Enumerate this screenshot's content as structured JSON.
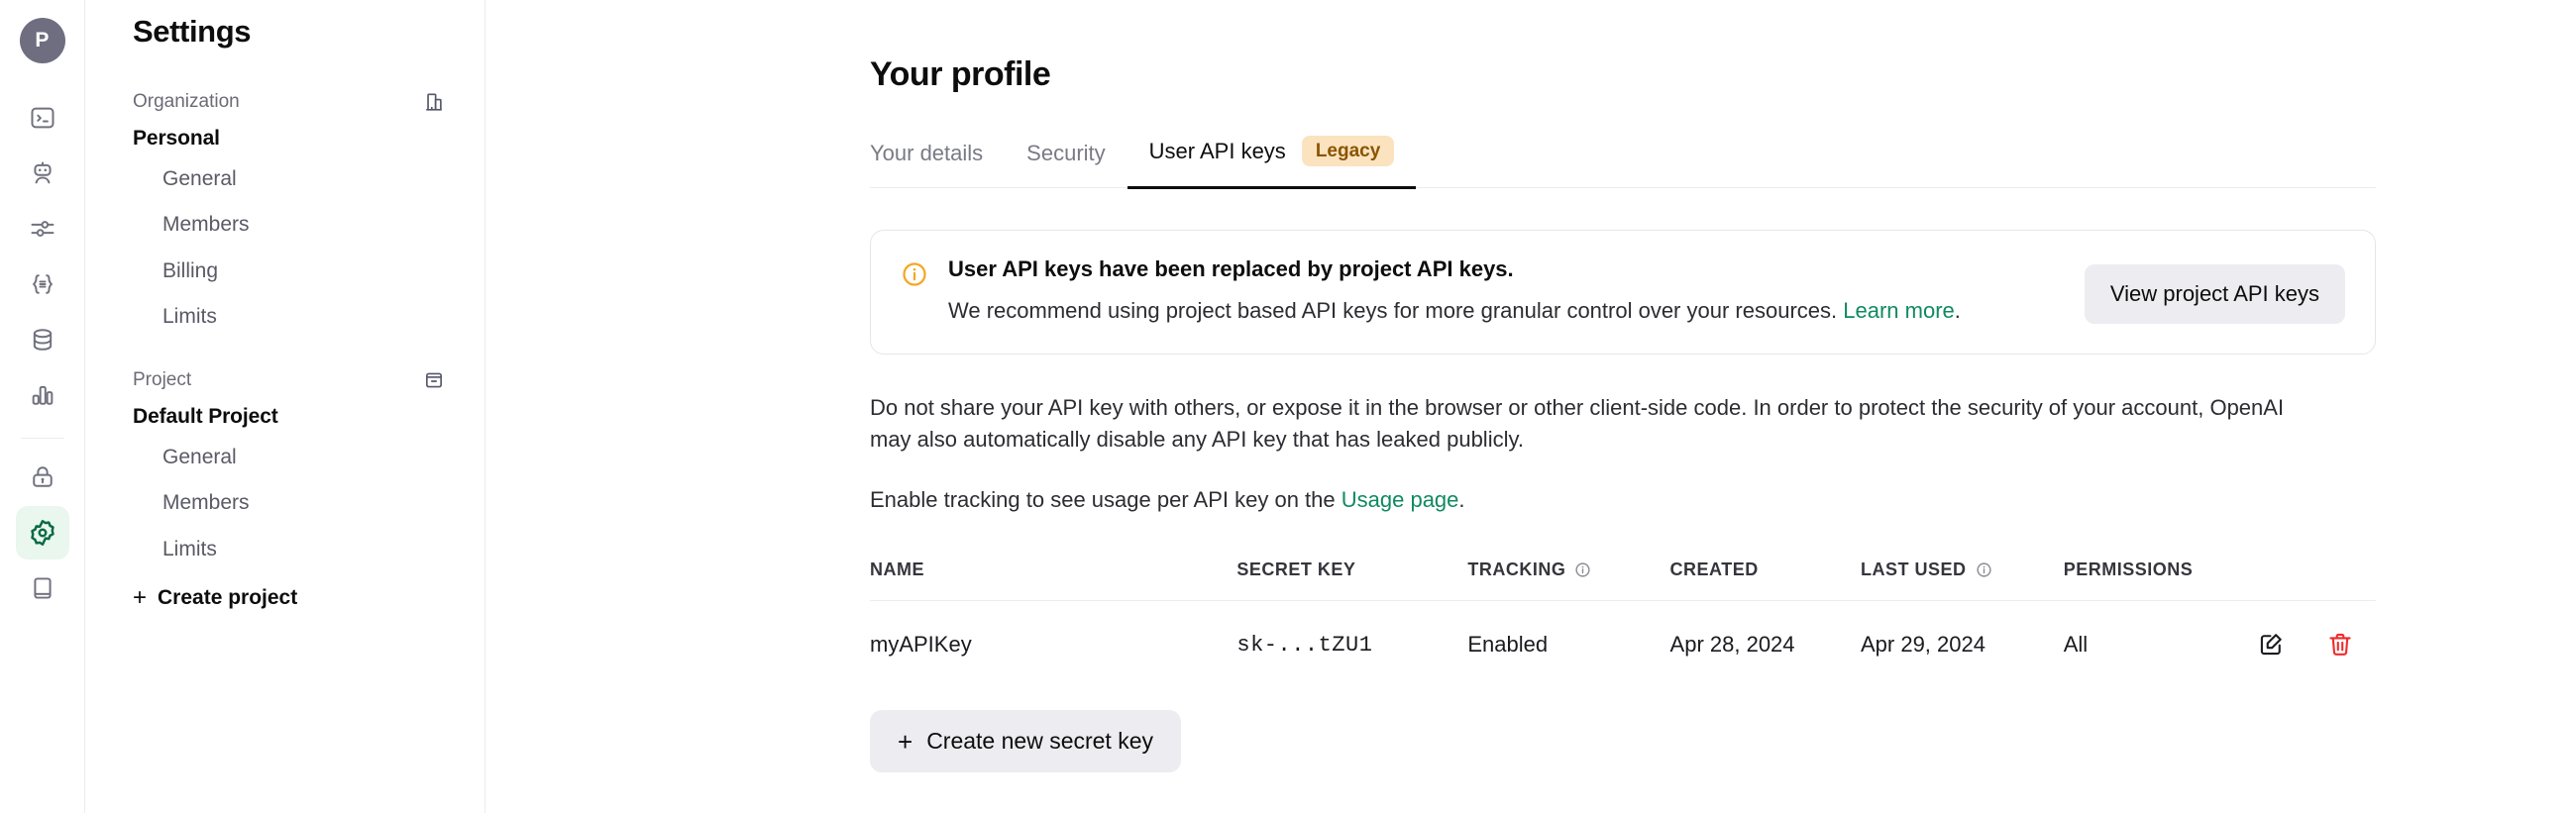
{
  "rail": {
    "avatar_initial": "P",
    "items": [
      {
        "name": "playground-icon",
        "title": "Playground"
      },
      {
        "name": "assistants-icon",
        "title": "Assistants"
      },
      {
        "name": "fine-tuning-icon",
        "title": "Fine-tuning"
      },
      {
        "name": "batches-icon",
        "title": "Batches"
      },
      {
        "name": "storage-icon",
        "title": "Storage"
      },
      {
        "name": "usage-icon",
        "title": "Usage"
      }
    ],
    "lower_items": [
      {
        "name": "api-keys-icon",
        "title": "API keys"
      },
      {
        "name": "settings-gear-icon",
        "title": "Settings",
        "active": true
      },
      {
        "name": "docs-book-icon",
        "title": "Docs"
      }
    ]
  },
  "nav": {
    "title": "Settings",
    "organization": {
      "label": "Organization",
      "icon": "building-icon",
      "name": "Personal",
      "links": [
        "General",
        "Members",
        "Billing",
        "Limits"
      ]
    },
    "project": {
      "label": "Project",
      "icon": "archive-box-icon",
      "name": "Default Project",
      "links": [
        "General",
        "Members",
        "Limits"
      ]
    },
    "create_project": "Create project",
    "plus": "+"
  },
  "main": {
    "page_title": "Your profile",
    "tabs": [
      {
        "label": "Your details",
        "active": false
      },
      {
        "label": "Security",
        "active": false
      },
      {
        "label": "User API keys",
        "active": true,
        "badge": "Legacy"
      }
    ],
    "banner": {
      "icon": "info-circle-icon",
      "title": "User API keys have been replaced by project API keys.",
      "description": "We recommend using project based API keys for more granular control over your resources.",
      "link": "Learn more",
      "period": ".",
      "button": "View project API keys"
    },
    "paragraph_1": "Do not share your API key with others, or expose it in the browser or other client-side code. In order to protect the security of your account, OpenAI may also automatically disable any API key that has leaked publicly.",
    "paragraph_2_pre": "Enable tracking to see usage per API key on the ",
    "paragraph_2_link": "Usage page",
    "paragraph_2_post": ".",
    "table": {
      "columns": [
        {
          "label": "NAME",
          "info": false
        },
        {
          "label": "SECRET KEY",
          "info": false
        },
        {
          "label": "TRACKING",
          "info": true
        },
        {
          "label": "CREATED",
          "info": false
        },
        {
          "label": "LAST USED",
          "info": true
        },
        {
          "label": "PERMISSIONS",
          "info": false
        }
      ],
      "rows": [
        {
          "name": "myAPIKey",
          "secret_key": "sk-...tZU1",
          "tracking": "Enabled",
          "created": "Apr 28, 2024",
          "last_used": "Apr 29, 2024",
          "permissions": "All",
          "edit_icon": "edit-pencil-icon",
          "delete_icon": "trash-icon"
        }
      ]
    },
    "create_key_button": "Create new secret key",
    "plus": "+"
  },
  "colors": {
    "accent_green": "#0f8a5f",
    "badge_bg": "#fbe3bf",
    "badge_text": "#8a5400",
    "info_orange": "#f5a623",
    "danger_red": "#ef2b2b",
    "button_grey": "#ececf1"
  }
}
